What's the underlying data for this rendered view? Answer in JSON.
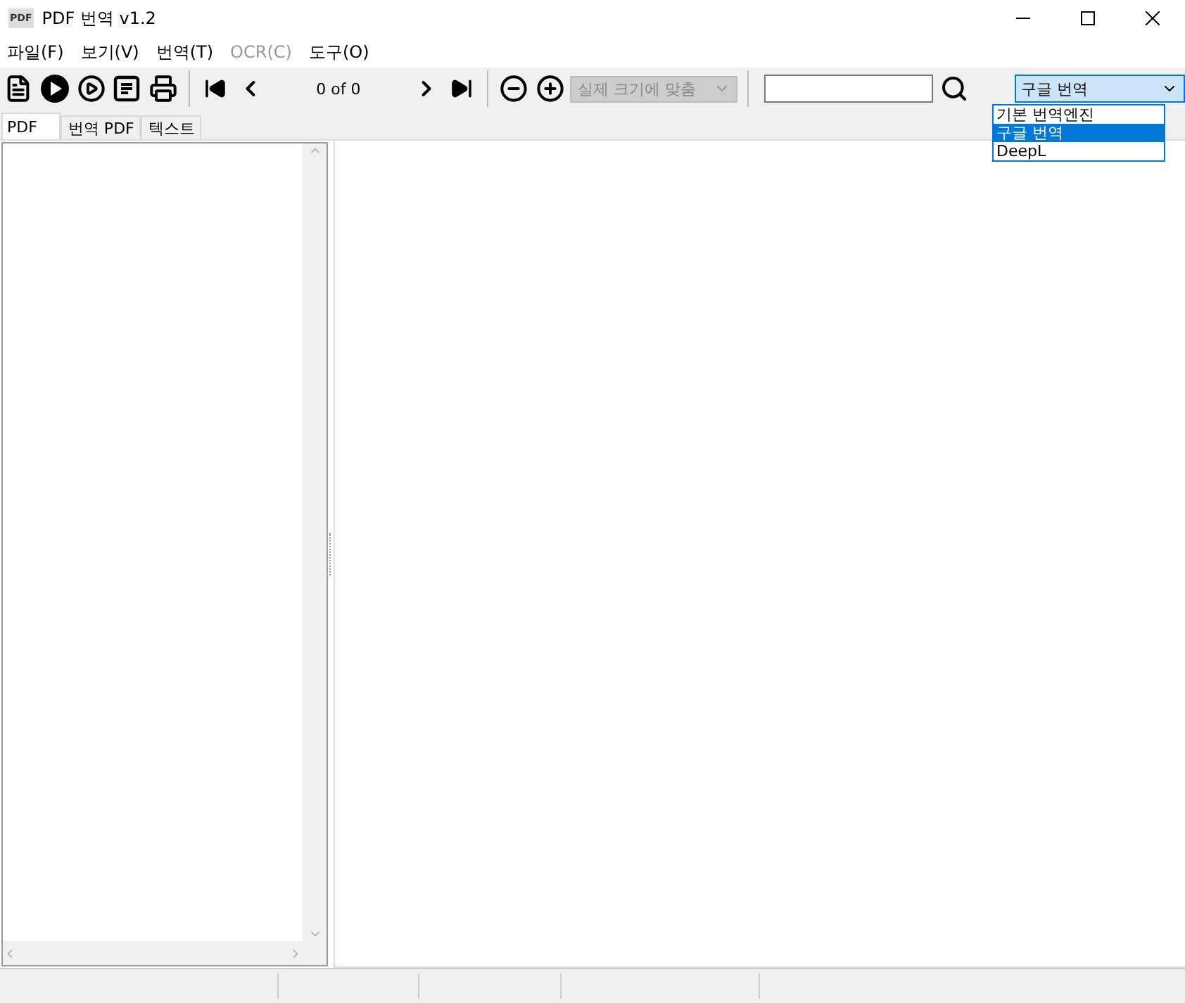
{
  "window": {
    "title": "PDF 번역 v1.2",
    "app_icon": "PDF"
  },
  "menu": [
    {
      "label": "파일(F)",
      "disabled": false
    },
    {
      "label": "보기(V)",
      "disabled": false
    },
    {
      "label": "번역(T)",
      "disabled": false
    },
    {
      "label": "OCR(C)",
      "disabled": true
    },
    {
      "label": "도구(O)",
      "disabled": false
    }
  ],
  "toolbar": {
    "page_indicator": "0 of 0",
    "zoom_select": {
      "value": "실제 크기에 맞춤",
      "disabled": true
    },
    "engine_select": {
      "value": "구글 번역",
      "expanded": true,
      "options": [
        {
          "label": "기본 번역엔진",
          "selected": false
        },
        {
          "label": "구글 번역",
          "selected": true
        },
        {
          "label": "DeepL",
          "selected": false
        }
      ]
    }
  },
  "tabs": [
    {
      "label": "PDF",
      "selected": true
    },
    {
      "label": "번역 PDF",
      "selected": false
    },
    {
      "label": "텍스트",
      "selected": false
    }
  ]
}
